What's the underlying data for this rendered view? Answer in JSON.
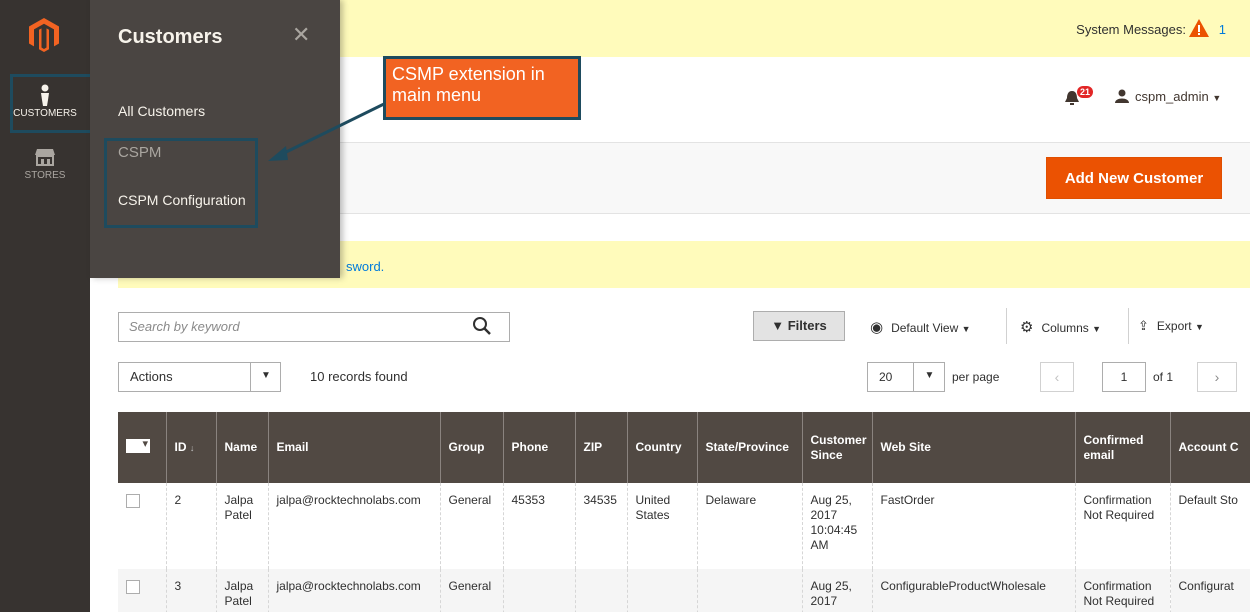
{
  "nav": {
    "items": [
      {
        "label": "CUSTOMERS",
        "icon": "customer-icon"
      },
      {
        "label": "STORES",
        "icon": "store-icon"
      }
    ]
  },
  "flyout": {
    "title": "Customers",
    "close": "✕",
    "all_customers": "All Customers",
    "group_label": "CSPM",
    "config_link": "CSPM Configuration"
  },
  "callout": {
    "text": "CSMP extension in main menu"
  },
  "system_messages": {
    "label": "System Messages:",
    "count": "1"
  },
  "header": {
    "notifications": "21",
    "user": "cspm_admin"
  },
  "page_actions": {
    "add_label": "Add New Customer"
  },
  "notice": {
    "text": "sword."
  },
  "toolbar": {
    "search_placeholder": "Search by keyword",
    "filters": "Filters",
    "default_view": "Default View",
    "columns": "Columns",
    "export": "Export"
  },
  "grid_controls": {
    "actions": "Actions",
    "records": "10 records found",
    "per_page_value": "20",
    "per_page_label": "per page",
    "page": "1",
    "of": "of 1"
  },
  "table": {
    "headers": [
      "ID",
      "Name",
      "Email",
      "Group",
      "Phone",
      "ZIP",
      "Country",
      "State/Province",
      "Customer Since",
      "Web Site",
      "Confirmed email",
      "Account C"
    ],
    "rows": [
      [
        "2",
        "Jalpa Patel",
        "jalpa@rocktechnolabs.com",
        "General",
        "45353",
        "34535",
        "United States",
        "Delaware",
        "Aug 25, 2017 10:04:45 AM",
        "FastOrder",
        "Confirmation Not Required",
        "Default Sto"
      ],
      [
        "3",
        "Jalpa Patel",
        "jalpa@rocktechnolabs.com",
        "General",
        "",
        "",
        "",
        "",
        "Aug 25, 2017",
        "ConfigurableProductWholesale",
        "Confirmation Not Required",
        "Configurat"
      ]
    ]
  },
  "colors": {
    "accent": "#eb5202",
    "nav": "#373330",
    "flyout": "#4a4542",
    "callout": "#f26322",
    "highlight": "#1e4b5e"
  }
}
